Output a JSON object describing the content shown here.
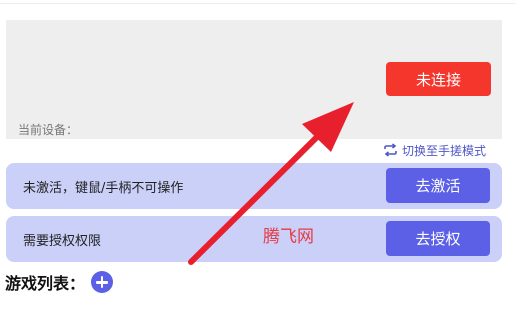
{
  "device_panel": {
    "connect_button": "未连接",
    "current_device_label": "当前设备："
  },
  "switch_mode": {
    "label": "切换至手搓模式",
    "icon": "swap-icon",
    "color": "#4f56c7"
  },
  "rows": [
    {
      "text": "未激活，键鼠/手柄不可操作",
      "button": "去激活"
    },
    {
      "text": "需要授权权限",
      "button": "去授权"
    }
  ],
  "watermark": "腾飞网",
  "game_list": {
    "title": "游戏列表：",
    "add_icon": "plus-circle-icon"
  },
  "colors": {
    "connect_red": "#f4362d",
    "primary_blue": "#5b60e6",
    "row_bg": "#cbd0f9",
    "annotation_arrow": "#e8202d"
  }
}
